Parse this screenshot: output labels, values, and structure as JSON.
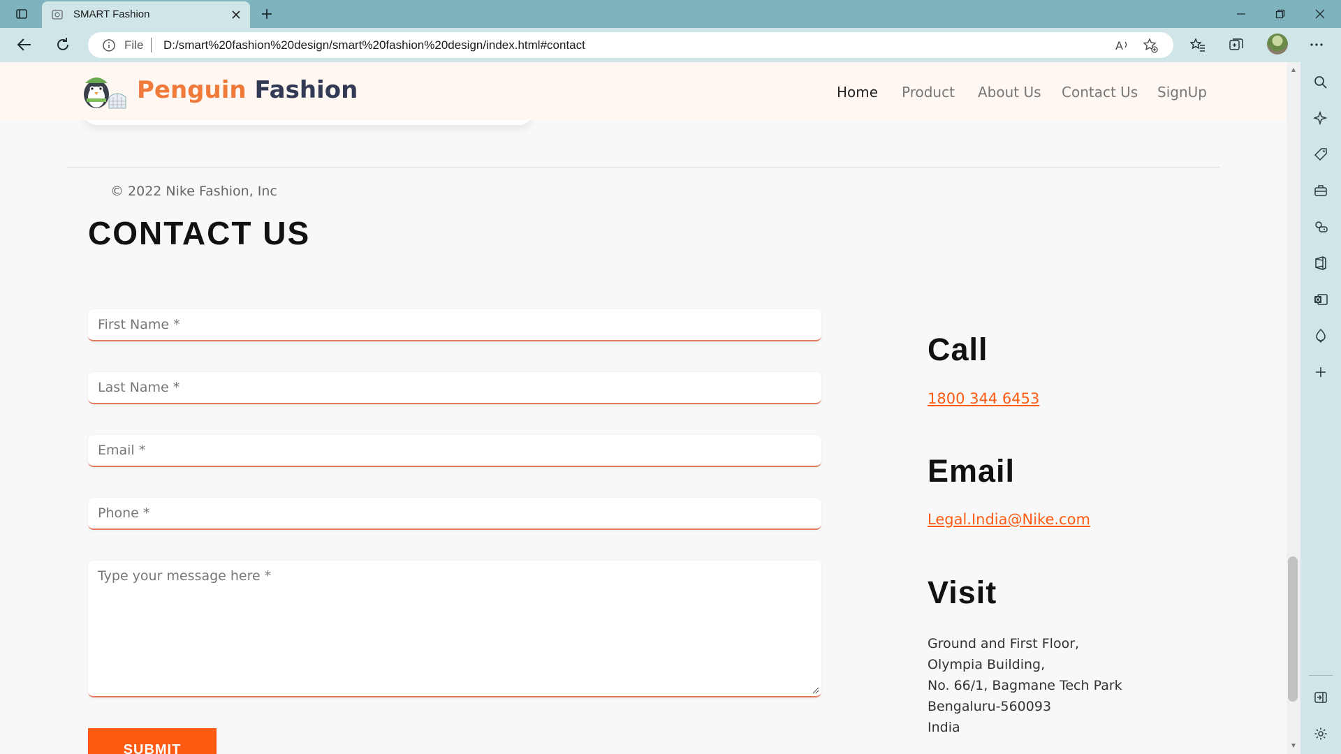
{
  "browser": {
    "tab_title": "SMART Fashion",
    "omnibox_scheme_label": "File",
    "url": "D:/smart%20fashion%20design/smart%20fashion%20design/index.html#contact"
  },
  "header": {
    "logo_primary": "Penguin",
    "logo_secondary": "Fashion",
    "nav": [
      "Home",
      "Product",
      "About Us",
      "Contact Us",
      "SignUp"
    ]
  },
  "footer": {
    "copyright": "© 2022 Nike Fashion, Inc"
  },
  "contact": {
    "title": "CONTACT US",
    "form": {
      "first_name_placeholder": "First Name *",
      "last_name_placeholder": "Last Name *",
      "email_placeholder": "Email *",
      "phone_placeholder": "Phone *",
      "message_placeholder": "Type your message here *",
      "submit_label": "SUBMIT"
    },
    "call": {
      "heading": "Call",
      "phone": "1800 344 6453"
    },
    "email": {
      "heading": "Email",
      "address": "Legal.India@Nike.com"
    },
    "visit": {
      "heading": "Visit",
      "lines": [
        "Ground and First Floor,",
        "Olympia Building,",
        "No. 66/1, Bagmane Tech Park",
        "Bengaluru-560093",
        "India"
      ]
    }
  },
  "colors": {
    "accent": "#ff5a12",
    "logo_orange": "#f07a3a",
    "logo_navy": "#333a55",
    "chrome": "#7fb3bd"
  }
}
